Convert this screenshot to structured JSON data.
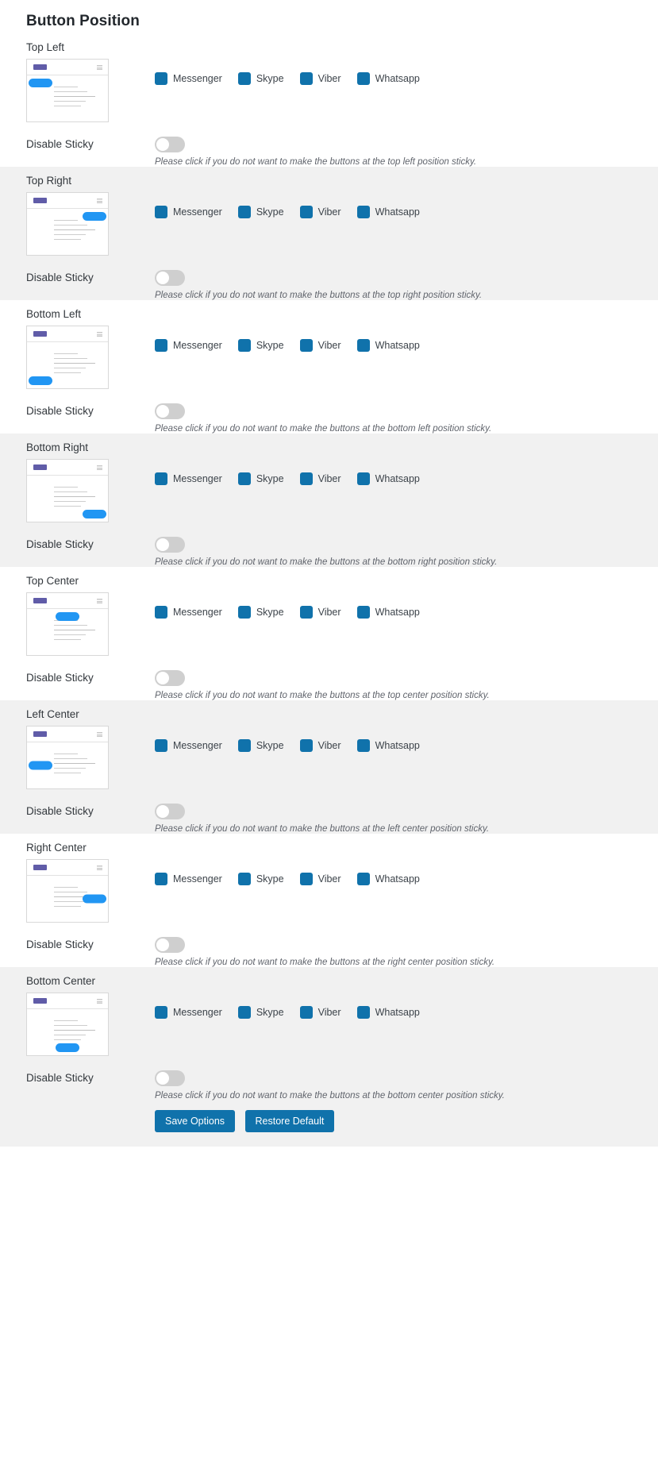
{
  "header": {
    "title": "Button Position"
  },
  "apps": [
    {
      "name": "Messenger",
      "checked": true,
      "color": "#1072ab"
    },
    {
      "name": "Skype",
      "checked": true,
      "color": "#1072ab"
    },
    {
      "name": "Viber",
      "checked": true,
      "color": "#1072ab"
    },
    {
      "name": "Whatsapp",
      "checked": true,
      "color": "#1072ab"
    }
  ],
  "sticky_label": "Disable Sticky",
  "positions": [
    {
      "label": "Top Left",
      "variant": "pv-topleft",
      "shaded": false,
      "sticky_label": "Disable Sticky",
      "note": "Please click if you do not want to make the buttons at the top left position sticky."
    },
    {
      "label": "Top Right",
      "variant": "pv-topright",
      "shaded": true,
      "sticky_label": "Disable Sticky",
      "note": "Please click if you do not want to make the buttons at the top right position sticky."
    },
    {
      "label": "Bottom Left",
      "variant": "pv-bottomleft",
      "shaded": false,
      "sticky_label": "Disable Sticky",
      "note": "Please click if you do not want to make the buttons at the bottom left position sticky."
    },
    {
      "label": "Bottom Right",
      "variant": "pv-bottomright",
      "shaded": true,
      "sticky_label": "Disable Sticky",
      "note": "Please click if you do not want to make the buttons at the bottom right position sticky."
    },
    {
      "label": "Top Center",
      "variant": "pv-topcenter",
      "shaded": false,
      "sticky_label": "Disable Sticky",
      "note": "Please click if you do not want to make the buttons at the top center position sticky."
    },
    {
      "label": "Left Center",
      "variant": "pv-leftcenter",
      "shaded": true,
      "sticky_label": "Disable Sticky",
      "note": "Please click if you do not want to make the buttons at the left center position sticky."
    },
    {
      "label": "Right Center",
      "variant": "pv-rightcenter",
      "shaded": false,
      "sticky_label": "Disable Sticky",
      "note": "Please click if you do not want to make the buttons at the right center position sticky."
    },
    {
      "label": "Bottom Center",
      "variant": "pv-bottomcenter",
      "shaded": true,
      "sticky_label": "Disable Sticky",
      "note": "Please click if you do not want to make the buttons at the bottom center position sticky."
    }
  ],
  "footer": {
    "save_label": "Save Options",
    "restore_label": "Restore Default"
  },
  "colors": {
    "accent": "#1072ab",
    "preview_pill": "#2196f3",
    "shaded_bg": "#f1f1f1",
    "toggle_off": "#cfcfcf"
  }
}
